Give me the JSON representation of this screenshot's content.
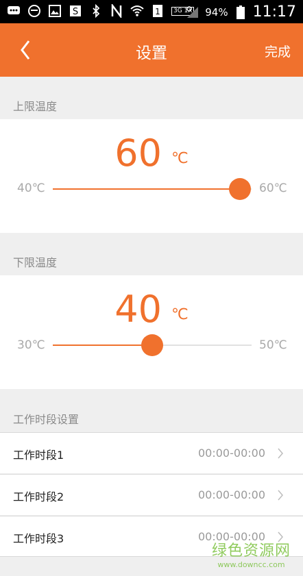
{
  "status_bar": {
    "network": "3G 1X",
    "battery": "94%",
    "time": "11:17"
  },
  "header": {
    "title": "设置",
    "done_label": "完成"
  },
  "upper_limit": {
    "section_title": "上限温度",
    "value": "60",
    "unit": "℃",
    "min_label": "40℃",
    "max_label": "60℃",
    "fraction": 0.94
  },
  "lower_limit": {
    "section_title": "下限温度",
    "value": "40",
    "unit": "℃",
    "min_label": "30℃",
    "max_label": "50℃",
    "fraction": 0.5
  },
  "work_periods": {
    "section_title": "工作时段设置",
    "items": [
      {
        "label": "工作时段1",
        "value": "00:00-00:00"
      },
      {
        "label": "工作时段2",
        "value": "00:00-00:00"
      },
      {
        "label": "工作时段3",
        "value": "00:00-00:00"
      }
    ]
  },
  "watermark": {
    "brand": "绿色资源网",
    "url": "www.downcc.com"
  },
  "colors": {
    "accent": "#f0712d",
    "background": "#efefef"
  }
}
